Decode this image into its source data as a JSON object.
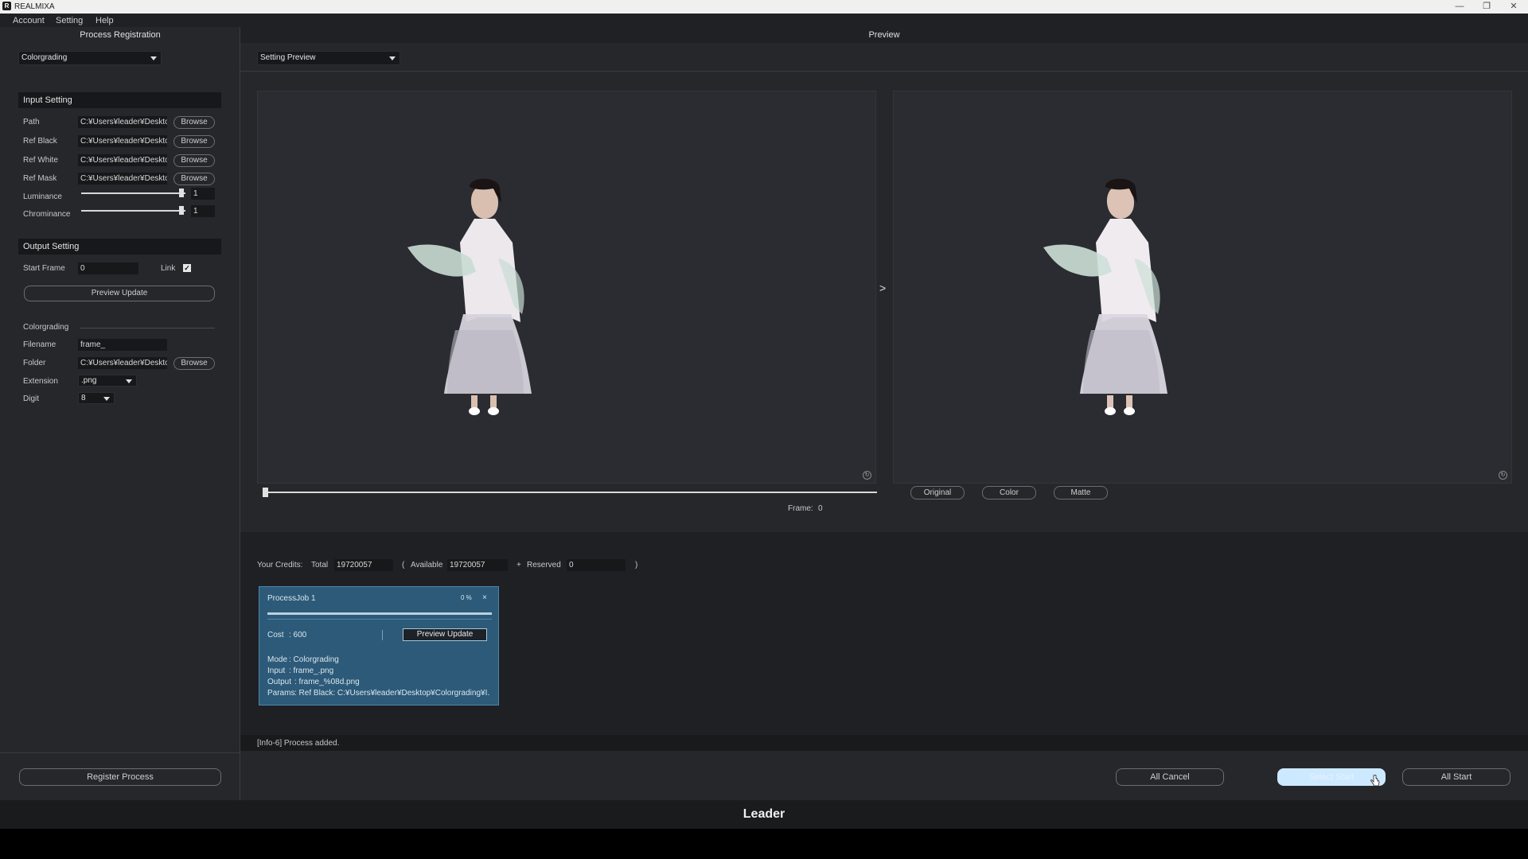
{
  "window": {
    "app_title": "REALMIXA",
    "app_icon_letter": "R"
  },
  "menu": [
    "Account",
    "Setting",
    "Help"
  ],
  "left": {
    "header": "Process Registration",
    "process_type": "Colorgrading",
    "input_setting": {
      "title": "Input Setting",
      "rows": [
        {
          "label": "Path",
          "value": "C:¥Users¥leader¥Desktop",
          "button": "Browse"
        },
        {
          "label": "Ref Black",
          "value": "C:¥Users¥leader¥Desktop",
          "button": "Browse"
        },
        {
          "label": "Ref White",
          "value": "C:¥Users¥leader¥Desktop",
          "button": "Browse"
        },
        {
          "label": "Ref Mask",
          "value": "C:¥Users¥leader¥Desktop",
          "button": "Browse"
        }
      ],
      "luminance": {
        "label": "Luminance",
        "value": "1",
        "level": 0.98
      },
      "chrominance": {
        "label": "Chrominance",
        "value": "1",
        "level": 0.98
      }
    },
    "output_setting": {
      "title": "Output Setting",
      "start_frame_label": "Start Frame",
      "start_frame": "0",
      "link_label": "Link",
      "link_checked": true,
      "preview_update": "Preview Update",
      "subsection": "Colorgrading",
      "filename_label": "Filename",
      "filename": "frame_",
      "folder_label": "Folder",
      "folder": "C:¥Users¥leader¥Desktop",
      "folder_button": "Browse",
      "extension_label": "Extension",
      "extension": ".png",
      "digit_label": "Digit",
      "digit": "8"
    },
    "register_button": "Register Process"
  },
  "preview": {
    "header": "Preview",
    "mode": "Setting Preview",
    "arrow": ">",
    "frame_label": "Frame:",
    "frame_value": "0",
    "slider_level": 0,
    "view_buttons": [
      "Original",
      "Color",
      "Matte"
    ]
  },
  "credits": {
    "label": "Your Credits:",
    "total_label": "Total",
    "total": "19720057",
    "open_paren": "(",
    "available_label": "Available",
    "available": "19720057",
    "plus": "+",
    "reserved_label": "Reserved",
    "reserved": "0",
    "close_paren": ")"
  },
  "job": {
    "title": "ProcessJob 1",
    "percent": "0 %",
    "close": "×",
    "progress": 0,
    "cost_label": "Cost",
    "cost": ": 600",
    "preview_update": "Preview Update",
    "mode_label": "Mode",
    "mode": ": Colorgrading",
    "input_label": "Input",
    "input": ": frame_.png",
    "output_label": "Output",
    "output": ": frame_%08d.png",
    "params_label": "Params",
    "params": ": Ref Black: C:¥Users¥leader¥Desktop¥Colorgrading¥I."
  },
  "status": "[Info-6] Process added.",
  "actions": {
    "all_cancel": "All Cancel",
    "select_start": "Select Start",
    "all_start": "All Start"
  },
  "footer_brand": "Leader",
  "colors": {
    "accent": "#cde9ff",
    "job_card": "#2d5a78"
  }
}
